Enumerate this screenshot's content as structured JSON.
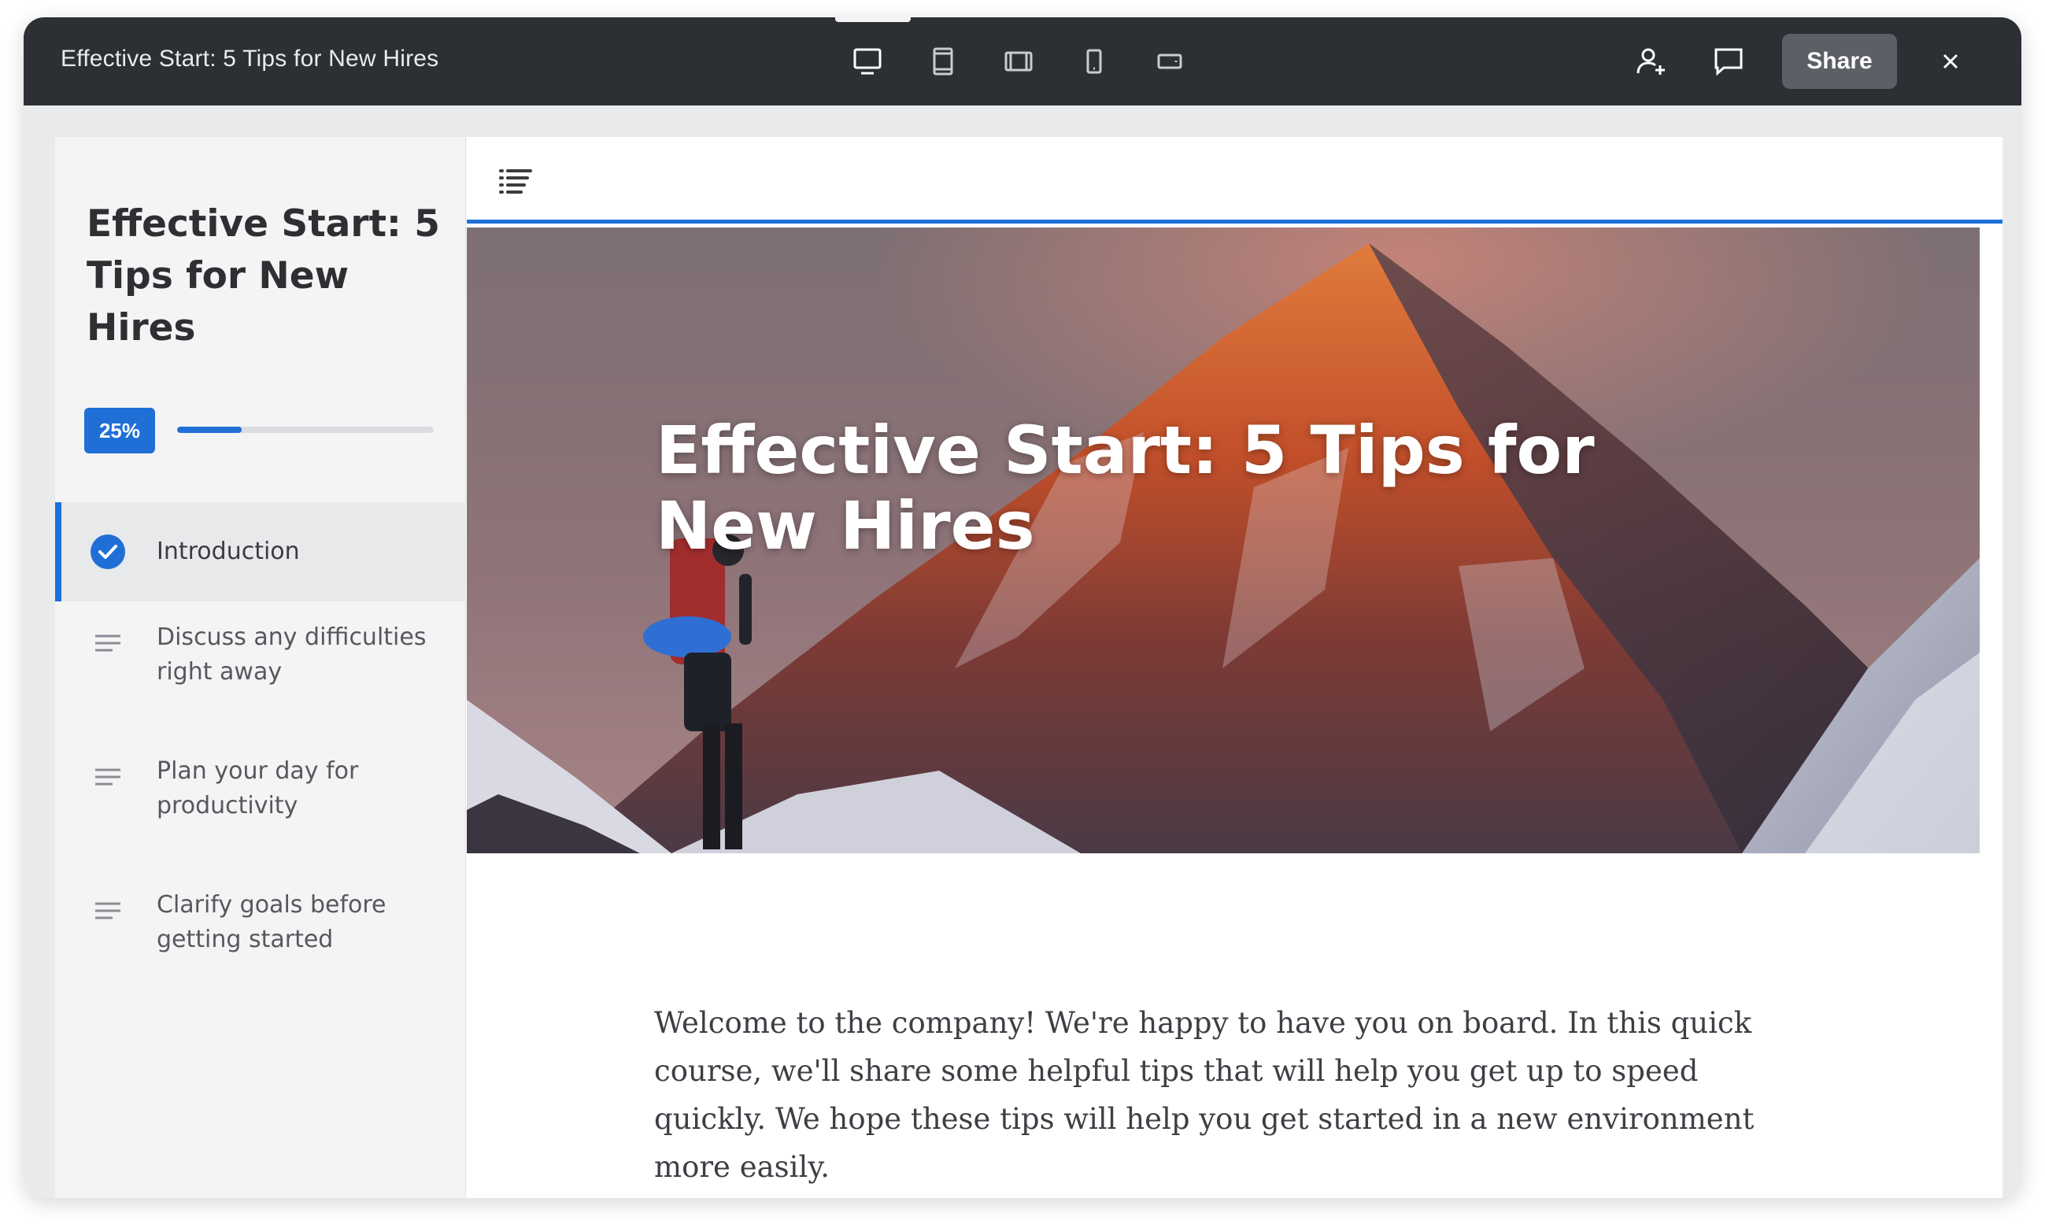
{
  "topbar": {
    "title": "Effective Start: 5 Tips for New Hires",
    "share_label": "Share",
    "device_icons": [
      "desktop-icon",
      "tablet-portrait-icon",
      "tablet-landscape-icon",
      "phone-portrait-icon",
      "phone-landscape-icon"
    ]
  },
  "sidebar": {
    "course_title": "Effective Start: 5 Tips for New Hires",
    "progress_label": "25%",
    "progress_value": 0.25,
    "items": [
      {
        "label": "Introduction",
        "status": "complete"
      },
      {
        "label": "Discuss any difficulties right away",
        "status": "not-started"
      },
      {
        "label": "Plan your day for productivity",
        "status": "not-started"
      },
      {
        "label": "Clarify goals before getting started",
        "status": "not-started"
      }
    ]
  },
  "main": {
    "hero_title": "Effective Start: 5 Tips for New Hires",
    "intro": "Welcome to the company! We're happy to have you on board. In this quick course, we'll share some helpful tips that will help you get up to speed quickly. We hope these tips will help you get started in a new environment more easily."
  },
  "colors": {
    "accent": "#1f6fd6",
    "topbar": "#2c2f33",
    "sidebar": "#f4f4f5"
  }
}
